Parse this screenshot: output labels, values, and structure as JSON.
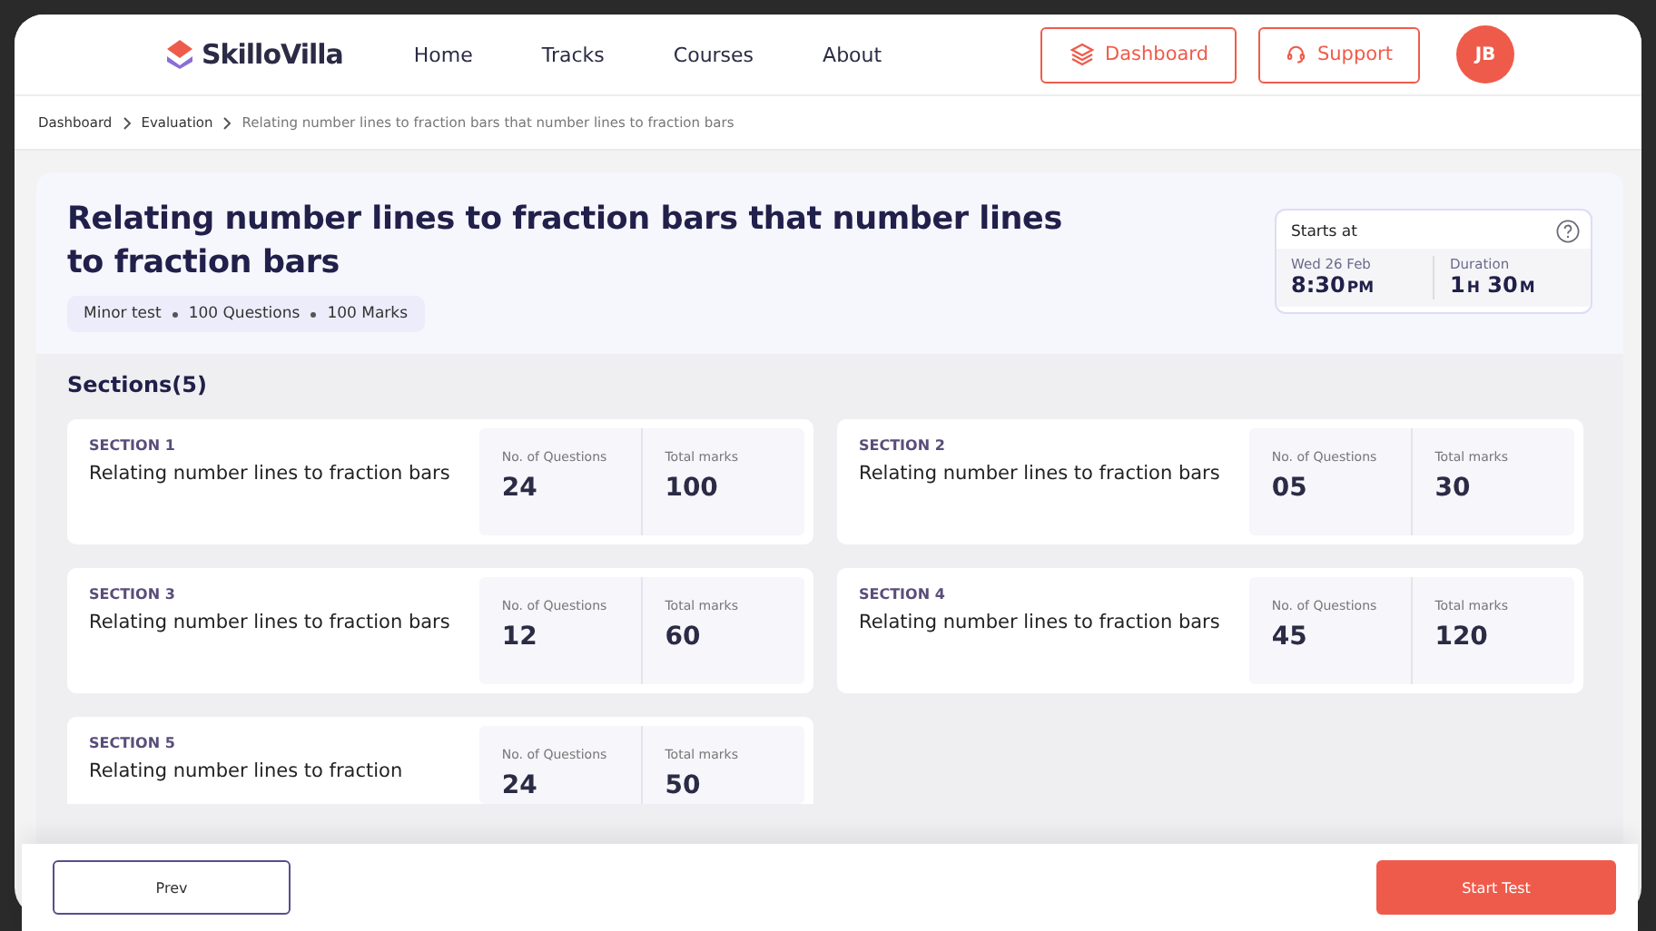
{
  "brand": {
    "name": "SkilloVilla"
  },
  "nav": [
    {
      "label": "Home"
    },
    {
      "label": "Tracks"
    },
    {
      "label": "Courses"
    },
    {
      "label": "About"
    }
  ],
  "actions": [
    {
      "label": "Dashboard",
      "kind": "dashboard"
    },
    {
      "label": "Support",
      "kind": "support"
    }
  ],
  "avatar": {
    "initials": "JB"
  },
  "breadcrumb": [
    "Dashboard",
    "Evaluation",
    "Relating number lines to fraction bars that number lines to fraction bars"
  ],
  "test": {
    "title": "Relating number lines to fraction bars that number lines to fraction bars",
    "meta": [
      "Minor test",
      "100 Questions",
      "100 Marks"
    ],
    "schedule": {
      "label": "Starts at",
      "date": "Wed 26 Feb",
      "time": "8:30",
      "ampm": "PM",
      "duration_label": "Duration",
      "hours": "1",
      "h_unit": "H",
      "minutes": "30",
      "m_unit": "M"
    }
  },
  "sections_title": "Sections(5)",
  "sections": [
    {
      "label": "SECTION 1",
      "name": "Relating number lines to fraction bars",
      "questions_label": "No. of Questions",
      "questions": "24",
      "marks_label": "Total marks",
      "marks": "100"
    },
    {
      "label": "SECTION 2",
      "name": "Relating number lines to fraction bars",
      "questions_label": "No. of Questions",
      "questions": "05",
      "marks_label": "Total marks",
      "marks": "30"
    },
    {
      "label": "SECTION 3",
      "name": "Relating number lines to fraction bars",
      "questions_label": "No. of Questions",
      "questions": "12",
      "marks_label": "Total marks",
      "marks": "60"
    },
    {
      "label": "SECTION 4",
      "name": "Relating number lines to fraction bars",
      "questions_label": "No. of Questions",
      "questions": "45",
      "marks_label": "Total marks",
      "marks": "120"
    },
    {
      "label": "SECTION 5",
      "name": "Relating number lines to fraction",
      "questions_label": "No. of Questions",
      "questions": "24",
      "marks_label": "Total marks",
      "marks": "50"
    }
  ],
  "footer": {
    "prev": "Prev",
    "start": "Start Test"
  }
}
